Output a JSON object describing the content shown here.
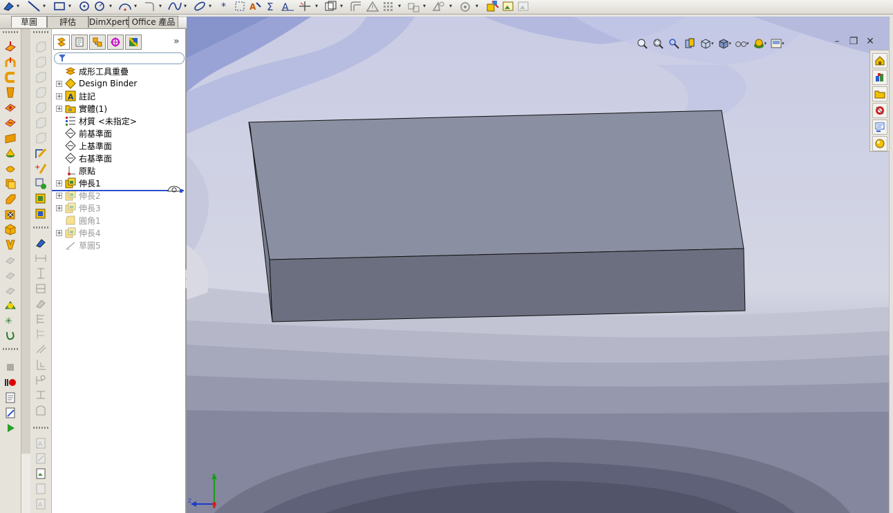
{
  "top_toolbar": {
    "tools": [
      "smart-dimension-icon",
      "line-icon",
      "rectangle-icon",
      "polygon-icon",
      "circle-icon",
      "arc-icon",
      "fillet-icon",
      "spline-icon",
      "ellipse-icon",
      "point-icon",
      "construction-icon",
      "relations-icon",
      "sketch-text-icon",
      "mirror-icon",
      "trim-icon",
      "convert-entities-icon",
      "offset-icon",
      "linear-pattern-icon",
      "move-icon",
      "display-relations-icon",
      "repair-sketch-icon",
      "rapid-sketch-icon",
      "instant3d-icon"
    ]
  },
  "command_tabs": [
    "草圖",
    "評估",
    "DimXpert",
    "Office 產品"
  ],
  "feature_manager": {
    "tabs": [
      "feature-manager-icon",
      "property-manager-icon",
      "configuration-manager-icon",
      "dimxpert-manager-icon",
      "display-manager-icon"
    ],
    "expand_symbol": "»",
    "tree": [
      {
        "label": "成形工具重疊",
        "icon": "part-icon",
        "expander": false,
        "suppressed": false
      },
      {
        "label": "Design Binder",
        "icon": "design-binder-icon",
        "expander": true,
        "suppressed": false
      },
      {
        "label": "註記",
        "icon": "annotations-icon",
        "expander": true,
        "suppressed": false
      },
      {
        "label": "實體(1)",
        "icon": "solid-bodies-icon",
        "expander": true,
        "suppressed": false
      },
      {
        "label": "材質 <未指定>",
        "icon": "material-icon",
        "expander": false,
        "suppressed": false
      },
      {
        "label": "前基準面",
        "icon": "plane-icon",
        "expander": false,
        "suppressed": false
      },
      {
        "label": "上基準面",
        "icon": "plane-icon",
        "expander": false,
        "suppressed": false
      },
      {
        "label": "右基準面",
        "icon": "plane-icon",
        "expander": false,
        "suppressed": false
      },
      {
        "label": "原點",
        "icon": "origin-icon",
        "expander": false,
        "suppressed": false
      },
      {
        "label": "伸長1",
        "icon": "extrude-icon",
        "expander": true,
        "suppressed": false
      },
      {
        "label": "伸長2",
        "icon": "extrude-icon",
        "expander": true,
        "suppressed": true
      },
      {
        "label": "伸長3",
        "icon": "extrude-icon",
        "expander": true,
        "suppressed": true
      },
      {
        "label": "圓角1",
        "icon": "fillet-feature-icon",
        "expander": false,
        "suppressed": true
      },
      {
        "label": "伸長4",
        "icon": "extrude-icon",
        "expander": true,
        "suppressed": true
      },
      {
        "label": "草圖5",
        "icon": "sketch-icon",
        "expander": false,
        "suppressed": true
      }
    ]
  },
  "view_toolbar": [
    "zoom-to-fit-icon",
    "zoom-to-area-icon",
    "previous-view-icon",
    "section-view-icon",
    "view-orientation-icon",
    "display-style-icon",
    "hide-show-items-icon",
    "edit-appearance-icon",
    "apply-scene-icon"
  ],
  "window_controls": {
    "minimize": "–",
    "restore": "❐",
    "close": "✕"
  },
  "task_pane": [
    "solidworks-resources-icon",
    "design-library-icon",
    "file-explorer-icon",
    "view-palette-icon",
    "appearances-icon",
    "custom-properties-icon"
  ],
  "triad": {
    "y": "Y",
    "z": "Z"
  },
  "colors": {
    "model_top": "#8a8fa2",
    "model_front": "#6b6f80",
    "model_side": "#787d8e",
    "rollback": "#2a4fd0"
  }
}
